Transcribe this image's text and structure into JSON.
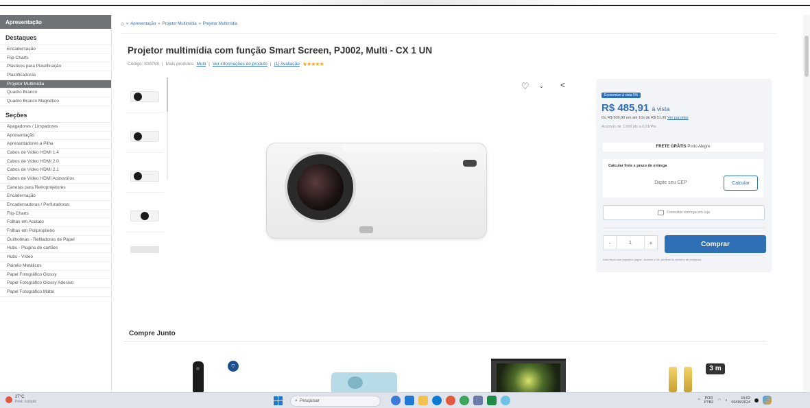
{
  "sidebar": {
    "header": "Apresentação",
    "section1": "Destaques",
    "items1": [
      "Encadernação",
      "Flip-Charts",
      "Plásticos para Plastificação",
      "Plastificadoras",
      "Projetor Multimídia",
      "Quadro Branco",
      "Quadro Branco Magnético"
    ],
    "active_index": 4,
    "section2": "Seções",
    "items2": [
      "Apagadores / Limpadores",
      "Apresentação",
      "Apresentadores a Pilha",
      "Cabos de Vídeo HDMI 1.4",
      "Cabos de Vídeo HDMI 2.0",
      "Cabos de Vídeo HDMI 2.1",
      "Cabos de Vídeo HDMI Acessórios",
      "Canetas para Retroprojetores",
      "Encadernação",
      "Encadernadoras / Perfuradoras",
      "Flip-Charts",
      "Folhas em Acetato",
      "Folhas em Polipropileno",
      "Guilhotinas - Refiladoras de Papel",
      "Hubs - Plugins de cartões",
      "Hubs - Vídeo",
      "Painéis Metálicos",
      "Papel Fotográfico Glossy",
      "Papel Fotográfico Glossy Adesivo",
      "Papel Fotográfico Matte"
    ]
  },
  "breadcrumb": [
    "Apresentação",
    "Projetor Multimídia",
    "Projetor Multimídia"
  ],
  "product": {
    "title": "Projetor multimídia com função Smart Screen, PJ002, Multi - CX 1 UN",
    "code": "Código: 808798",
    "more_from": "Mais produtos",
    "brand": "Multi",
    "info_link": "Ver informações do produto",
    "reviews": "(1) Avaliação",
    "stars": "★★★★★"
  },
  "buybox": {
    "promo": "Economize à vista 5%",
    "price": "R$ 485,91",
    "price_suffix": "à vista",
    "installment": "Ou R$ 509,90 em até 10x de R$ 51,99",
    "installment_link": "Ver parcelas",
    "points": "Acúmulo de 1.000 pts a 0,01/Pts.",
    "frete_bold": "FRETE GRÁTIS",
    "frete_rest": "Porto Alegre",
    "calc_title": "Calcular frete e prazo de entrega",
    "cep_placeholder": "Digite seu CEP",
    "calc_button": "Calcular",
    "store_pickup": "Consultar entrega em loja",
    "qty_minus": "-",
    "qty_value": "1",
    "qty_plus": "+",
    "buy_button": "Comprar",
    "note": "Nota fiscal com impostos pagos - Acesse o IVL (ao final do carrinho de compras)."
  },
  "bundle": {
    "title": "Compre Junto",
    "badge": "3 m"
  },
  "taskbar": {
    "temp": "27°C",
    "weather": "Pred. nublado",
    "search": "Pesquisar",
    "lang1": "POR",
    "lang2": "PTB2",
    "time": "15:02",
    "date": "03/05/2024"
  },
  "colors": {
    "accent": "#2f6fb5",
    "sidebar_active": "#6f7276",
    "stars": "#f3a51a"
  }
}
